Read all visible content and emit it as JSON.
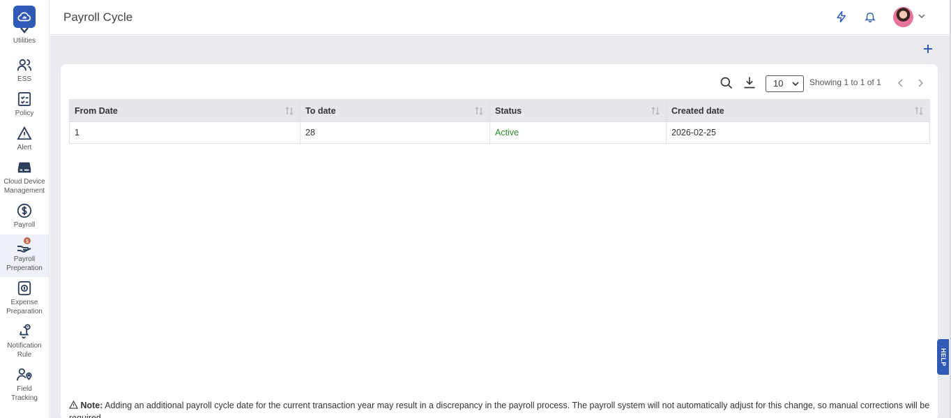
{
  "header": {
    "title": "Payroll Cycle"
  },
  "sidebar": {
    "items": [
      {
        "label": "Utilities",
        "icon": "utilities-icon"
      },
      {
        "label": "ESS",
        "icon": "users-icon"
      },
      {
        "label": "Policy",
        "icon": "policy-checklist-icon"
      },
      {
        "label": "Alert",
        "icon": "alert-triangle-icon"
      },
      {
        "label": "Cloud Device Management",
        "icon": "device-icon"
      },
      {
        "label": "Payroll",
        "icon": "dollar-circle-icon"
      },
      {
        "label": "Payroll Preperation",
        "icon": "hand-coin-icon"
      },
      {
        "label": "Expense Preparation",
        "icon": "expense-icon"
      },
      {
        "label": "Notification Rule",
        "icon": "bell-alert-icon"
      },
      {
        "label": "Field Tracking",
        "icon": "user-location-icon"
      }
    ]
  },
  "toolbar": {
    "page_size": "10",
    "showing": "Showing 1 to 1 of 1"
  },
  "table": {
    "columns": [
      "From Date",
      "To date",
      "Status",
      "Created date"
    ],
    "rows": [
      {
        "from_date": "1",
        "to_date": "28",
        "status": "Active",
        "created": "2026-02-25"
      }
    ]
  },
  "note": {
    "prefix": "Note:",
    "text": " Adding an additional payroll cycle date for the current transaction year may result in a discrepancy in the payroll process. The payroll system will not automatically adjust for this change, so manual corrections will be required."
  },
  "help": {
    "label": "HELP"
  },
  "colors": {
    "brand": "#2f5bb7",
    "status_active": "#2e8b2e"
  }
}
